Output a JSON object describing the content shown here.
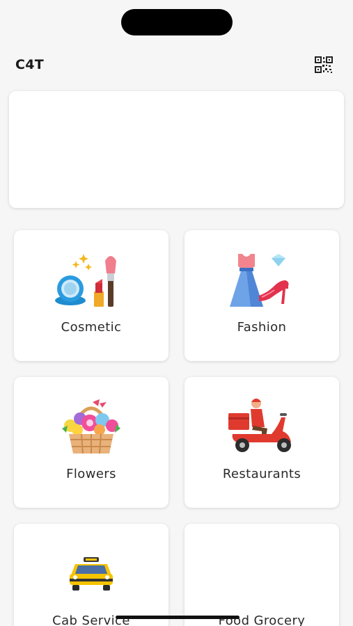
{
  "app": {
    "title": "C4T"
  },
  "header": {
    "qr_icon": "qr-code-icon"
  },
  "banner": {},
  "categories": [
    {
      "label": "Cosmetic",
      "icon": "cosmetic-icon"
    },
    {
      "label": "Fashion",
      "icon": "fashion-icon"
    },
    {
      "label": "Flowers",
      "icon": "flowers-icon"
    },
    {
      "label": "Restaurants",
      "icon": "restaurant-delivery-icon"
    },
    {
      "label": "Cab Service",
      "icon": "taxi-icon"
    },
    {
      "label": "Food Grocery",
      "icon": "grocery-icon"
    }
  ],
  "colors": {
    "background": "#f6f6f6",
    "card": "#ffffff",
    "text": "#2a2a2a"
  }
}
